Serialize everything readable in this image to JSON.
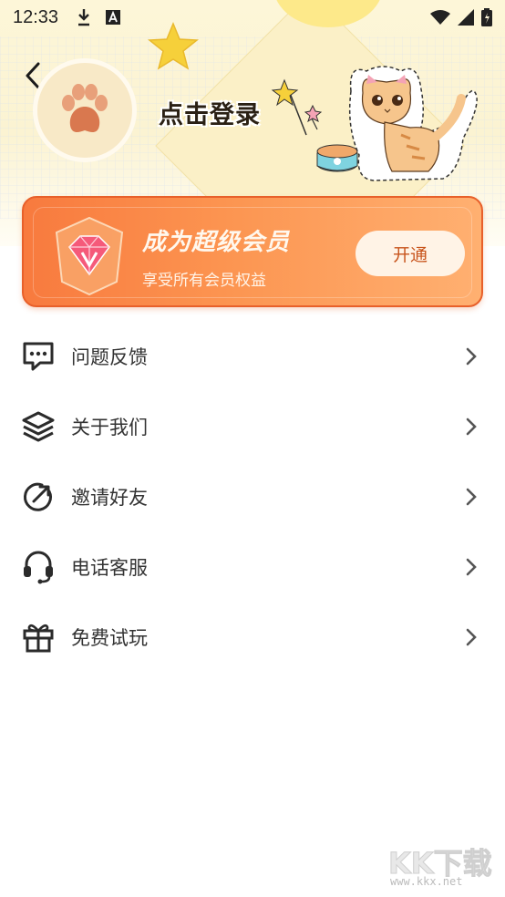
{
  "status_bar": {
    "time": "12:33"
  },
  "profile": {
    "login_text": "点击登录"
  },
  "vip": {
    "title": "成为超级会员",
    "subtitle": "享受所有会员权益",
    "button_label": "开通"
  },
  "menu": {
    "items": [
      {
        "label": "问题反馈",
        "icon": "feedback-icon"
      },
      {
        "label": "关于我们",
        "icon": "layers-icon"
      },
      {
        "label": "邀请好友",
        "icon": "share-arrow-icon"
      },
      {
        "label": "电话客服",
        "icon": "headset-icon"
      },
      {
        "label": "免费试玩",
        "icon": "gift-icon"
      }
    ]
  },
  "watermark": {
    "text": "KK下载",
    "url": "www.kkx.net"
  },
  "colors": {
    "accent": "#f87a3e",
    "vip_button_text": "#c8541c",
    "header_bg": "#fdf6d8"
  }
}
